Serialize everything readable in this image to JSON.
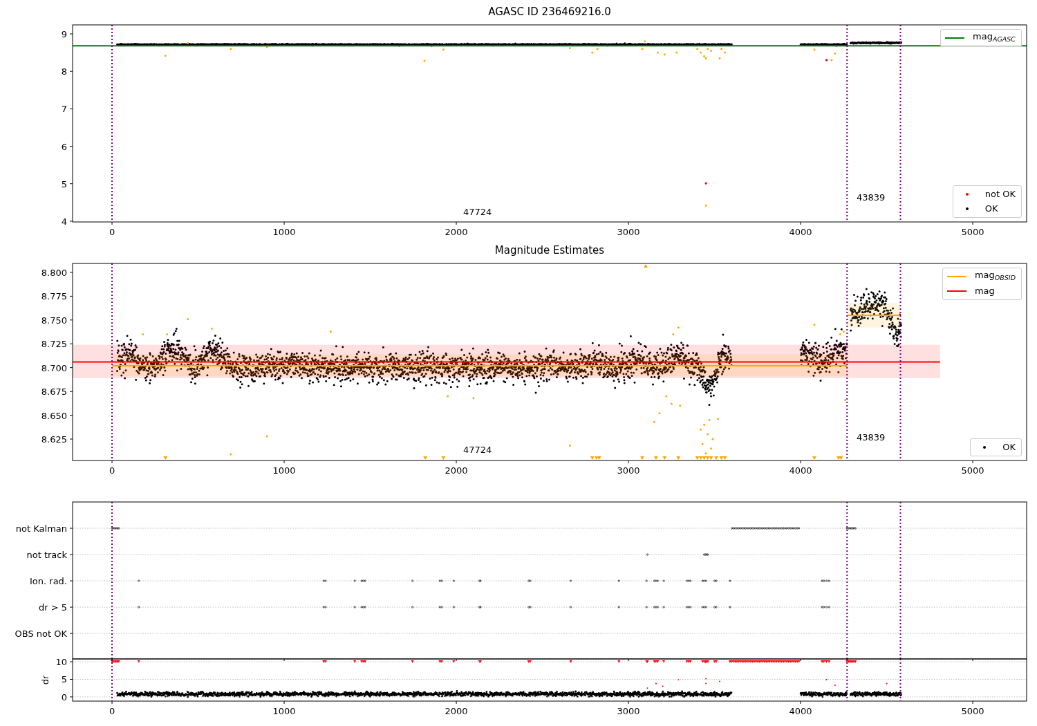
{
  "panels": [
    {
      "kind": "mag-agasc",
      "chart_data": {
        "type": "line",
        "title": "AGASC ID 236469216.0",
        "xlim": [
          -229,
          5313
        ],
        "ylim": [
          3.98,
          9.24
        ],
        "xticks": [
          0,
          1000,
          2000,
          3000,
          4000,
          5000
        ],
        "yticks": [
          4,
          5,
          6,
          7,
          8,
          9
        ],
        "series": [
          {
            "name": "mag$_{AGASC}$",
            "color": "#008000",
            "x": [
              -229,
              5313
            ],
            "values": [
              8.68,
              8.68
            ]
          }
        ],
        "ref_lines": [
          {
            "axis": "x",
            "value": 0
          },
          {
            "axis": "x",
            "value": 4270
          },
          {
            "axis": "x",
            "value": 4580
          }
        ],
        "annotations": [
          "47724",
          "43839"
        ]
      },
      "point_legend": [
        {
          "label": "not OK",
          "color": "#ff0000"
        },
        {
          "label": "OK",
          "color": "#000000"
        }
      ]
    },
    {
      "kind": "mag-estimates",
      "chart_data": {
        "type": "line",
        "title": "Magnitude Estimates",
        "xlim": [
          -229,
          5313
        ],
        "ylim": [
          8.6025,
          8.8094
        ],
        "xticks": [
          0,
          1000,
          2000,
          3000,
          4000,
          5000
        ],
        "yticks": [
          {
            "value": 8.625,
            "label": "8.625"
          },
          {
            "value": 8.65,
            "label": "8.650"
          },
          {
            "value": 8.675,
            "label": "8.675"
          },
          {
            "value": 8.7,
            "label": "8.700"
          },
          {
            "value": 8.725,
            "label": "8.725"
          },
          {
            "value": 8.75,
            "label": "8.750"
          },
          {
            "value": 8.775,
            "label": "8.775"
          },
          {
            "value": 8.8,
            "label": "8.800"
          }
        ],
        "series": [
          {
            "name": "mag$_{OBSID}$",
            "color": "#ffa500",
            "x": [
              0,
              4270,
              4270,
              4580
            ],
            "values": [
              8.702,
              8.702,
              8.755,
              8.755
            ]
          },
          {
            "name": "mag",
            "color": "#ff0000",
            "x": [
              -229,
              4810
            ],
            "values": [
              8.706,
              8.706
            ]
          }
        ],
        "bands": [
          {
            "axis": "y",
            "from": 8.689,
            "to": 8.724,
            "color": "#ff0000"
          },
          {
            "axis": "y",
            "from": 8.691,
            "to": 8.714,
            "color": "#ffa500"
          },
          {
            "axis": "y",
            "from": 8.742,
            "to": 8.768,
            "color": "#ffa500"
          }
        ],
        "ref_lines": [
          {
            "axis": "x",
            "value": 0
          },
          {
            "axis": "x",
            "value": 4270
          },
          {
            "axis": "x",
            "value": 4580
          }
        ],
        "annotations": [
          "47724",
          "43839"
        ]
      },
      "point_legend": [
        {
          "label": "OK",
          "color": "#000000"
        }
      ]
    },
    {
      "kind": "flags",
      "row_labels": [
        "not Kalman",
        "not track",
        "Ion. rad.",
        "dr > 5",
        "OBS not OK"
      ]
    },
    {
      "kind": "dr",
      "chart_data": {
        "type": "scatter",
        "ylabel": "dr",
        "grid": true,
        "xlim": [
          -229,
          5313
        ],
        "ylim": [
          -1.2,
          10.8
        ],
        "xticks": [
          0,
          1000,
          2000,
          3000,
          4000,
          5000
        ],
        "yticks": [
          0,
          5,
          10
        ],
        "ref_lines": [
          {
            "axis": "x",
            "value": 0
          },
          {
            "axis": "x",
            "value": 4270
          },
          {
            "axis": "x",
            "value": 4580
          }
        ]
      }
    }
  ]
}
